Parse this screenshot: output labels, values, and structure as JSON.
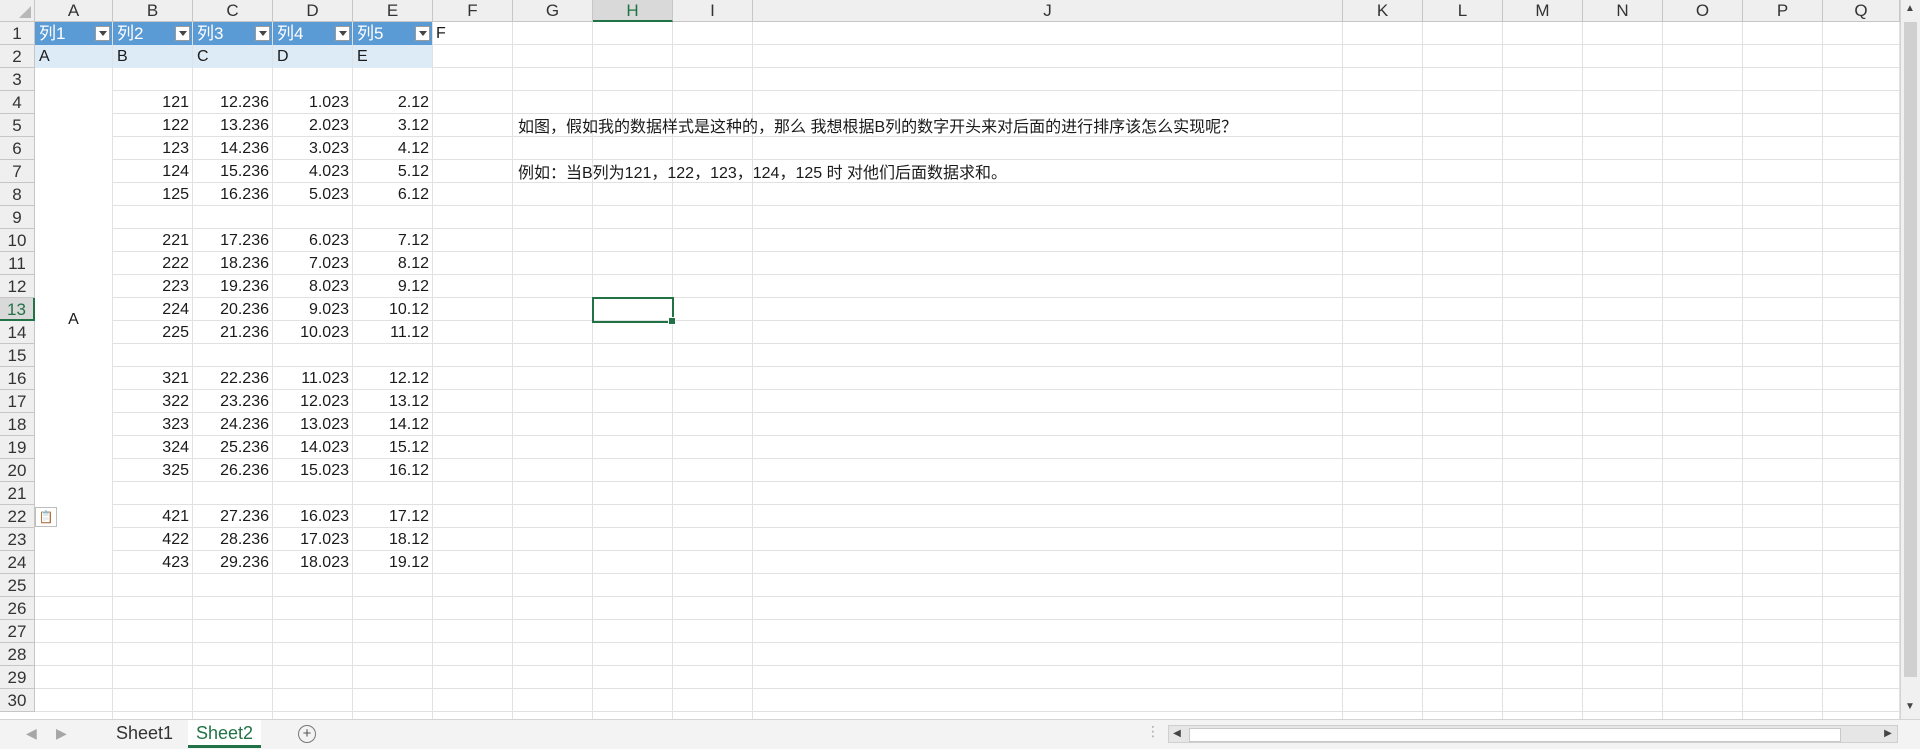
{
  "columns": [
    "A",
    "B",
    "C",
    "D",
    "E",
    "F",
    "G",
    "H",
    "I",
    "J",
    "K",
    "L",
    "M",
    "N",
    "O",
    "P",
    "Q"
  ],
  "rows": [
    "1",
    "2",
    "3",
    "4",
    "5",
    "6",
    "7",
    "8",
    "9",
    "10",
    "11",
    "12",
    "13",
    "14",
    "15",
    "16",
    "17",
    "18",
    "19",
    "20",
    "21",
    "22",
    "23",
    "24",
    "25",
    "26",
    "27",
    "28",
    "29",
    "30"
  ],
  "selected_cell": "H13",
  "table": {
    "headers": [
      "列1",
      "列2",
      "列3",
      "列4",
      "列5"
    ],
    "row2": [
      "A",
      "B",
      "C",
      "D",
      "E"
    ],
    "side_label": "F",
    "merged_label": "A",
    "data": [
      {
        "row": "4",
        "values": [
          "121",
          "12.236",
          "1.023",
          "2.12"
        ]
      },
      {
        "row": "5",
        "values": [
          "122",
          "13.236",
          "2.023",
          "3.12"
        ]
      },
      {
        "row": "6",
        "values": [
          "123",
          "14.236",
          "3.023",
          "4.12"
        ]
      },
      {
        "row": "7",
        "values": [
          "124",
          "15.236",
          "4.023",
          "5.12"
        ]
      },
      {
        "row": "8",
        "values": [
          "125",
          "16.236",
          "5.023",
          "6.12"
        ]
      },
      {
        "row": "10",
        "values": [
          "221",
          "17.236",
          "6.023",
          "7.12"
        ]
      },
      {
        "row": "11",
        "values": [
          "222",
          "18.236",
          "7.023",
          "8.12"
        ]
      },
      {
        "row": "12",
        "values": [
          "223",
          "19.236",
          "8.023",
          "9.12"
        ]
      },
      {
        "row": "13",
        "values": [
          "224",
          "20.236",
          "9.023",
          "10.12"
        ]
      },
      {
        "row": "14",
        "values": [
          "225",
          "21.236",
          "10.023",
          "11.12"
        ]
      },
      {
        "row": "16",
        "values": [
          "321",
          "22.236",
          "11.023",
          "12.12"
        ]
      },
      {
        "row": "17",
        "values": [
          "322",
          "23.236",
          "12.023",
          "13.12"
        ]
      },
      {
        "row": "18",
        "values": [
          "323",
          "24.236",
          "13.023",
          "14.12"
        ]
      },
      {
        "row": "19",
        "values": [
          "324",
          "25.236",
          "14.023",
          "15.12"
        ]
      },
      {
        "row": "20",
        "values": [
          "325",
          "26.236",
          "15.023",
          "16.12"
        ]
      },
      {
        "row": "22",
        "values": [
          "421",
          "27.236",
          "16.023",
          "17.12"
        ]
      },
      {
        "row": "23",
        "values": [
          "422",
          "28.236",
          "17.023",
          "18.12"
        ]
      },
      {
        "row": "24",
        "values": [
          "423",
          "29.236",
          "18.023",
          "19.12"
        ]
      }
    ]
  },
  "notes": {
    "g5": "如图，假如我的数据样式是这种的，那么  我想根据B列的数字开头来对后面的进行排序该怎么实现呢？",
    "g7": "例如：当B列为121，122，123，124，125 时 对他们后面数据求和。"
  },
  "tabs": [
    "Sheet1",
    "Sheet2"
  ],
  "active_tab": "Sheet2",
  "icons": {
    "paste_options": "paste-options-icon",
    "add_sheet": "plus-circle-icon",
    "filter": "filter-dropdown-icon"
  },
  "colors": {
    "header_blue": "#5b9bd5",
    "band_light_blue": "#ddebf7",
    "excel_green": "#217346"
  }
}
